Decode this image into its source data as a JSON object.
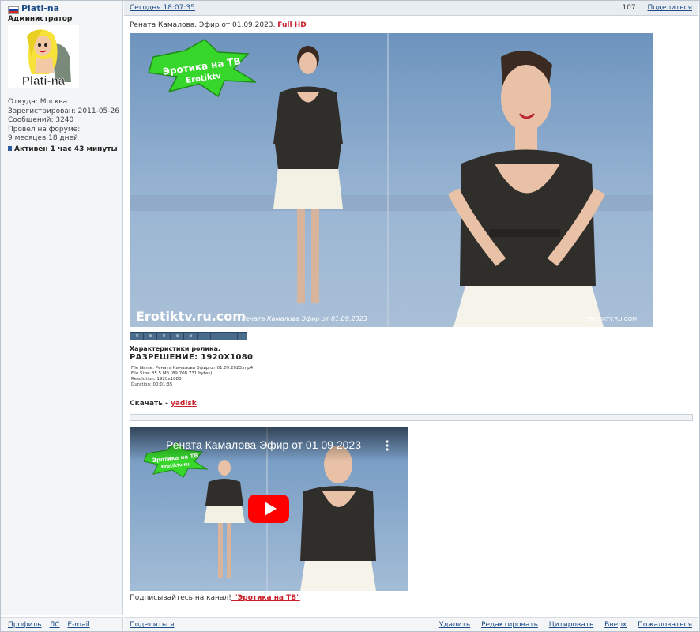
{
  "author": {
    "name": "Plati-na",
    "flag_colors": [
      "#ffffff",
      "#1c3f9b",
      "#d52b1e"
    ],
    "rank": "Администратор",
    "avatar_caption": "Plati-na",
    "info_lines": [
      "Откуда: Москва",
      "Зарегистрирован: 2011-05-26",
      "Сообщений: 3240",
      "Провел на форуме:",
      "9 месяцев 18 дней"
    ],
    "active": "Активен 1 час 43 минуты",
    "footer_links": [
      "Профиль",
      "ЛС",
      "E-mail"
    ]
  },
  "post": {
    "timestamp": "Сегодня 18:07:35",
    "number": "107",
    "share_label": "Поделиться",
    "title_text": "Рената Камалова. Эфир от 01.09.2023.",
    "title_highlight": "Full HD",
    "image": {
      "logo_line1": "Эротика на ТВ",
      "logo_line2": "Erotiktv",
      "watermark_site": "Erotiktv.ru.com",
      "watermark_caption": "Рената Камалова Эфир от 01.09.2023",
      "watermark_right": "EROTIKTV.RU.COM"
    },
    "specs_title": "Характеристики ролика.",
    "resolution": "РАЗРЕШЕНИЕ: 1920X1080",
    "file_info": [
      "File Name: Рената Камалова Эфир от 01.09.2023.mp4",
      "File Size: 85.5 Мб (89 708 731 bytes)",
      "Resolution: 1920x1080",
      "Duration: 00:01:35"
    ],
    "download_prefix": "Скачать - ",
    "download_link": "yadisk",
    "video": {
      "title": "Рената Камалова Эфир от 01 09 2023",
      "logo_line1": "Эротика на ТВ",
      "logo_line2": "Erotiktv.ru"
    },
    "subscribe_prefix": "Подписывайтесь на канал!",
    "subscribe_link": " \"Эротика на ТВ\"",
    "footer_left": "Поделиться",
    "footer_actions": [
      "Удалить",
      "Редактировать",
      "Цитировать",
      "Вверх",
      "Пожаловаться"
    ]
  }
}
